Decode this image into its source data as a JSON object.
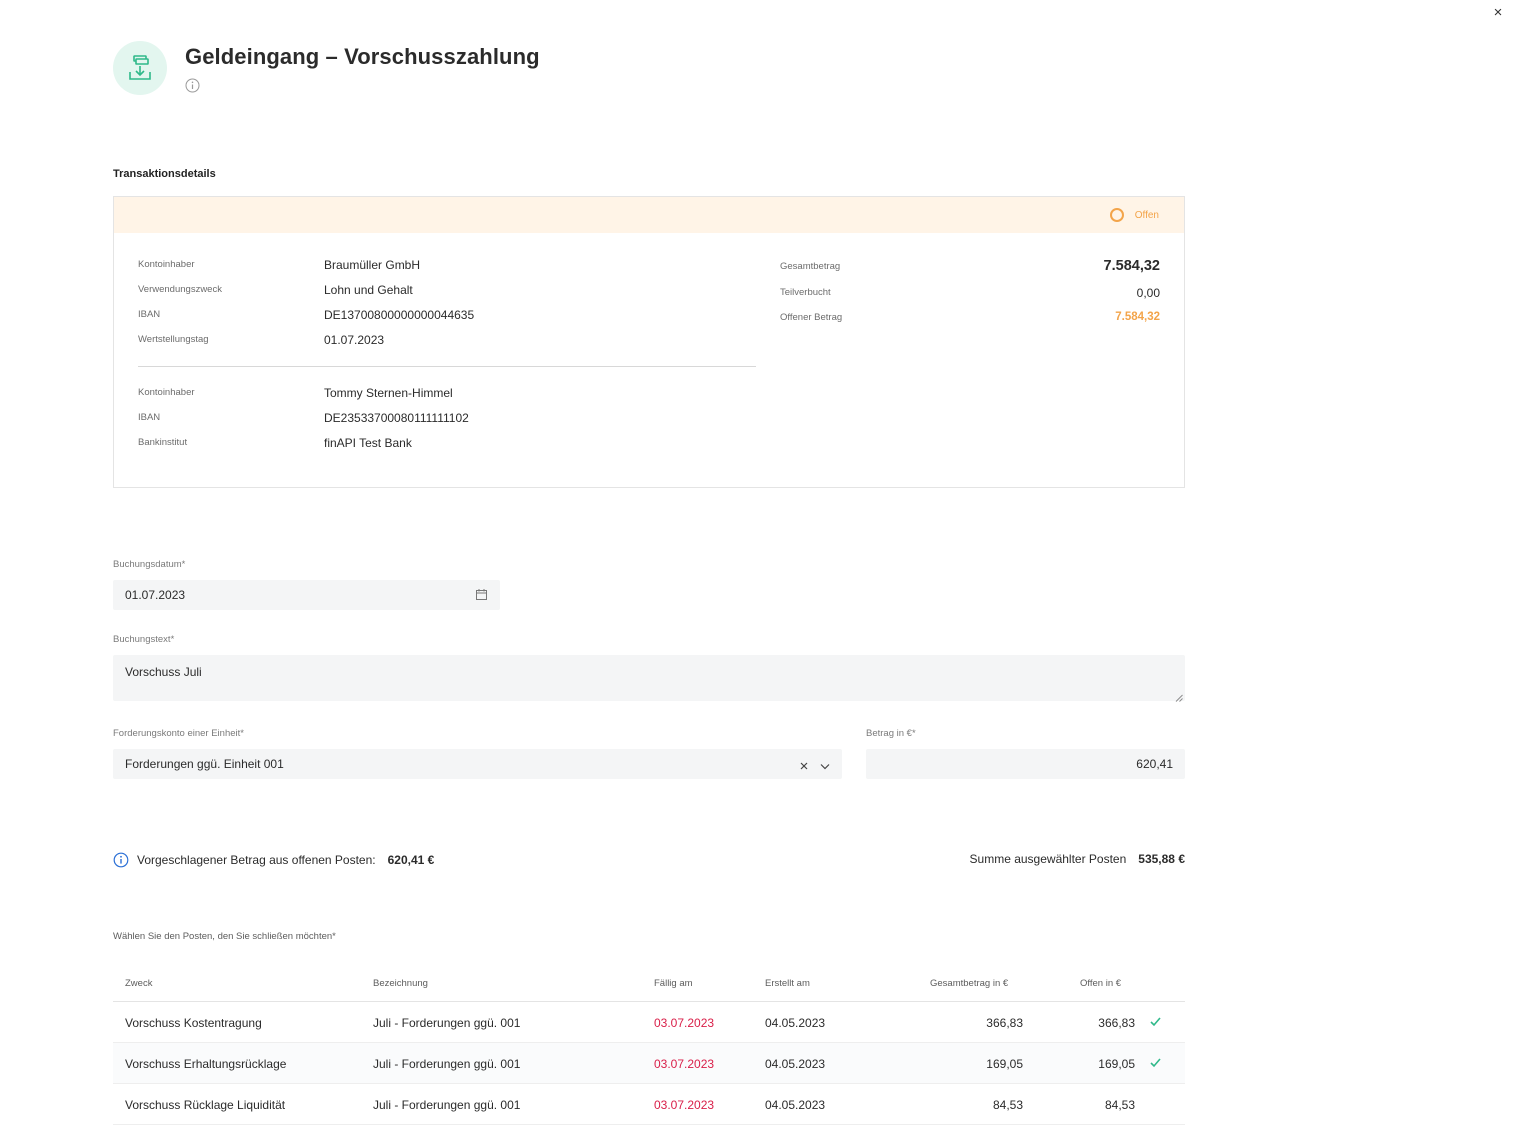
{
  "window": {
    "close_label": "×"
  },
  "header": {
    "title": "Geldeingang – Vorschusszahlung"
  },
  "section": {
    "title": "Transaktionsdetails"
  },
  "transaction": {
    "status": "Offen",
    "status_color": "#f3a44a",
    "sender": [
      {
        "key": "Kontoinhaber",
        "value": "Braumüller GmbH"
      },
      {
        "key": "Verwendungszweck",
        "value": "Lohn und Gehalt"
      },
      {
        "key": "IBAN",
        "value": "DE13700800000000044635"
      },
      {
        "key": "Wertstellungstag",
        "value": "01.07.2023"
      }
    ],
    "receiver": [
      {
        "key": "Kontoinhaber",
        "value": "Tommy Sternen-Himmel"
      },
      {
        "key": "IBAN",
        "value": "DE23533700080111111102"
      },
      {
        "key": "Bankinstitut",
        "value": "finAPI Test Bank"
      }
    ],
    "summary": [
      {
        "key": "Gesamtbetrag",
        "value": "7.584,32"
      },
      {
        "key": "Teilverbucht",
        "value": "0,00"
      },
      {
        "key": "Offener Betrag",
        "value": "7.584,32"
      }
    ]
  },
  "form": {
    "booking_date_label": "Buchungsdatum*",
    "booking_date_value": "01.07.2023",
    "booking_text_label": "Buchungstext*",
    "booking_text_value": "Vorschuss Juli",
    "account_label": "Forderungskonto einer Einheit*",
    "account_value": "Forderungen ggü. Einheit 001",
    "amount_label": "Betrag in €*",
    "amount_value": "620,41"
  },
  "suggestion": {
    "label": "Vorgeschlagener Betrag aus offenen Posten:",
    "value": "620,41 €",
    "selected_label": "Summe ausgewählter Posten",
    "selected_value": "535,88 €"
  },
  "table": {
    "instruction": "Wählen Sie den Posten, den Sie schließen möchten*",
    "headers": [
      "Zweck",
      "Bezeichnung",
      "Fällig am",
      "Erstellt am",
      "Gesamtbetrag in €",
      "Offen in €"
    ],
    "rows": [
      {
        "zweck": "Vorschuss Kostentragung",
        "bezeichnung": "Juli - Forderungen ggü. 001",
        "faellig": "03.07.2023",
        "erstellt": "04.05.2023",
        "gesamt": "366,83",
        "offen": "366,83",
        "selected": true
      },
      {
        "zweck": "Vorschuss Erhaltungsrücklage",
        "bezeichnung": "Juli - Forderungen ggü. 001",
        "faellig": "03.07.2023",
        "erstellt": "04.05.2023",
        "gesamt": "169,05",
        "offen": "169,05",
        "selected": true
      },
      {
        "zweck": "Vorschuss Rücklage Liquidität",
        "bezeichnung": "Juli - Forderungen ggü. 001",
        "faellig": "03.07.2023",
        "erstellt": "04.05.2023",
        "gesamt": "84,53",
        "offen": "84,53",
        "selected": false
      }
    ]
  },
  "colors": {
    "accent_green": "#2fb98a",
    "due_red": "#d91e48",
    "info_blue": "#2a6fd6"
  }
}
